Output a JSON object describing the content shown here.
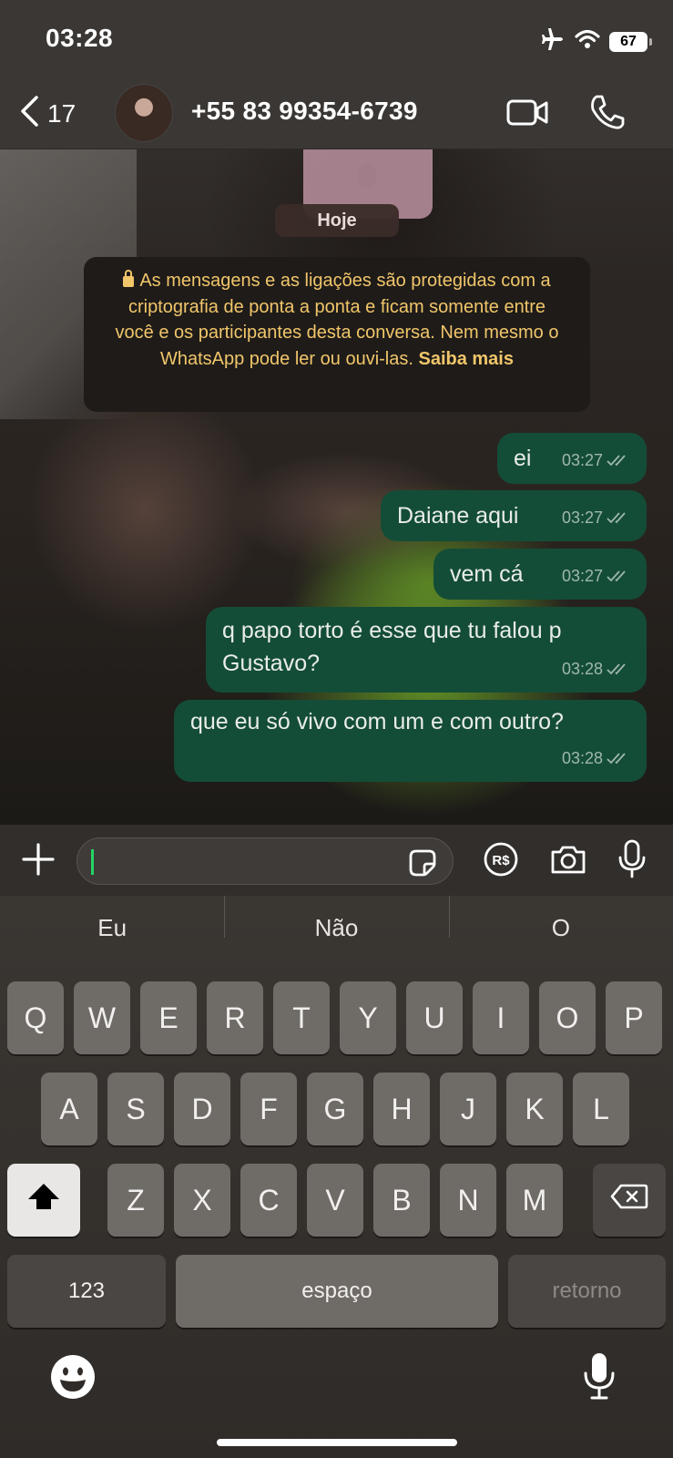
{
  "status_bar": {
    "time": "03:28",
    "battery": "67",
    "icons": [
      "airplane-icon",
      "wifi-icon",
      "battery-icon"
    ]
  },
  "header": {
    "back_count": "17",
    "contact": "+55 83 99354-6739",
    "icons": [
      "chevron-left-icon",
      "avatar",
      "video-call-icon",
      "phone-icon"
    ]
  },
  "chat": {
    "date_chip": "Hoje",
    "encryption_notice": {
      "text": "As mensagens e as ligações são protegidas com a criptografia de ponta a ponta e ficam somente entre você e os participantes desta conversa. Nem mesmo o WhatsApp pode ler ou ouvi-las.",
      "link": "Saiba mais"
    },
    "messages": [
      {
        "text": "ei",
        "time": "03:27"
      },
      {
        "text": "Daiane aqui",
        "time": "03:27"
      },
      {
        "text": "vem cá",
        "time": "03:27"
      },
      {
        "text": "q papo torto é esse que tu falou p Gustavo?",
        "time": "03:28"
      },
      {
        "text": "que eu só vivo com um e com outro?",
        "time": "03:28"
      }
    ]
  },
  "input_bar": {
    "message_value": "",
    "icons": [
      "plus-icon",
      "sticker-icon",
      "pix-icon",
      "camera-icon",
      "microphone-icon"
    ]
  },
  "keyboard": {
    "suggestions": [
      "Eu",
      "Não",
      "O"
    ],
    "row1": [
      "Q",
      "W",
      "E",
      "R",
      "T",
      "Y",
      "U",
      "I",
      "O",
      "P"
    ],
    "row2": [
      "A",
      "S",
      "D",
      "F",
      "G",
      "H",
      "J",
      "K",
      "L"
    ],
    "row3": [
      "Z",
      "X",
      "C",
      "V",
      "B",
      "N",
      "M"
    ],
    "numbers_key": "123",
    "space_key": "espaço",
    "return_key": "retorno"
  },
  "colors": {
    "bubble": "#144d37",
    "notice_text": "#f1c66a",
    "caret": "#25d366"
  }
}
